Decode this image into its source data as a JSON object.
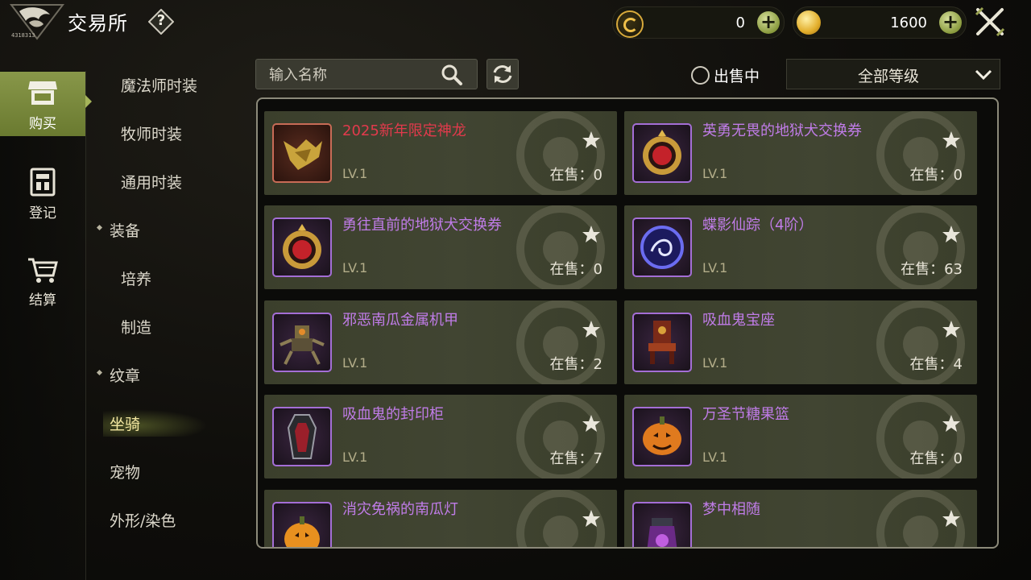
{
  "header": {
    "title": "交易所",
    "help_label": "?",
    "logo_id": "4318313",
    "currency_1": {
      "icon": "c-coin-icon",
      "value": "0",
      "plus": "+"
    },
    "currency_2": {
      "icon": "gold-coin-icon",
      "value": "1600",
      "plus": "+"
    }
  },
  "leftnav": {
    "items": [
      {
        "label": "购买",
        "icon": "shop-icon",
        "active": true
      },
      {
        "label": "登记",
        "icon": "register-icon",
        "active": false
      },
      {
        "label": "结算",
        "icon": "cart-icon",
        "active": false
      }
    ]
  },
  "categories": [
    {
      "label": "魔法师时装",
      "type": "sub"
    },
    {
      "label": "牧师时装",
      "type": "sub"
    },
    {
      "label": "通用时装",
      "type": "sub"
    },
    {
      "label": "装备",
      "type": "top"
    },
    {
      "label": "培养",
      "type": "sub"
    },
    {
      "label": "制造",
      "type": "sub"
    },
    {
      "label": "纹章",
      "type": "top"
    },
    {
      "label": "坐骑",
      "type": "top-active"
    },
    {
      "label": "宠物",
      "type": "plain"
    },
    {
      "label": "外形/染色",
      "type": "plain"
    }
  ],
  "toolbar": {
    "search_placeholder": "输入名称",
    "on_sale_label": "出售中",
    "level_filter": "全部等级"
  },
  "items": [
    {
      "name": "2025新年限定神龙",
      "level": "LV.1",
      "on_sale": "在售：0",
      "rarity": "red",
      "icon": "golden-dragon-icon"
    },
    {
      "name": "英勇无畏的地狱犬交换券",
      "level": "LV.1",
      "on_sale": "在售：0",
      "rarity": "purple",
      "icon": "hellhound-ticket-icon"
    },
    {
      "name": "勇往直前的地狱犬交换券",
      "level": "LV.1",
      "on_sale": "在售：0",
      "rarity": "purple",
      "icon": "hellhound-ticket-icon"
    },
    {
      "name": "蝶影仙踪（4阶）",
      "level": "LV.1",
      "on_sale": "在售：63",
      "rarity": "purple",
      "icon": "blue-orb-icon"
    },
    {
      "name": "邪恶南瓜金属机甲",
      "level": "LV.1",
      "on_sale": "在售：2",
      "rarity": "purple",
      "icon": "pumpkin-mech-icon"
    },
    {
      "name": "吸血鬼宝座",
      "level": "LV.1",
      "on_sale": "在售：4",
      "rarity": "purple",
      "icon": "vampire-throne-icon"
    },
    {
      "name": "吸血鬼的封印柜",
      "level": "LV.1",
      "on_sale": "在售：7",
      "rarity": "purple",
      "icon": "vampire-coffin-icon"
    },
    {
      "name": "万圣节糖果篮",
      "level": "LV.1",
      "on_sale": "在售：0",
      "rarity": "purple",
      "icon": "pumpkin-basket-icon"
    },
    {
      "name": "消灾免祸的南瓜灯",
      "level": "",
      "on_sale": "",
      "rarity": "purple",
      "icon": "pumpkin-lantern-icon"
    },
    {
      "name": "梦中相随",
      "level": "",
      "on_sale": "",
      "rarity": "purple",
      "icon": "sleep-potion-icon"
    }
  ],
  "colors": {
    "accent_green": "#889749",
    "rarity_red": "#e23a4c",
    "rarity_purple": "#c07ce8",
    "panel_border": "#8c8a7a"
  }
}
